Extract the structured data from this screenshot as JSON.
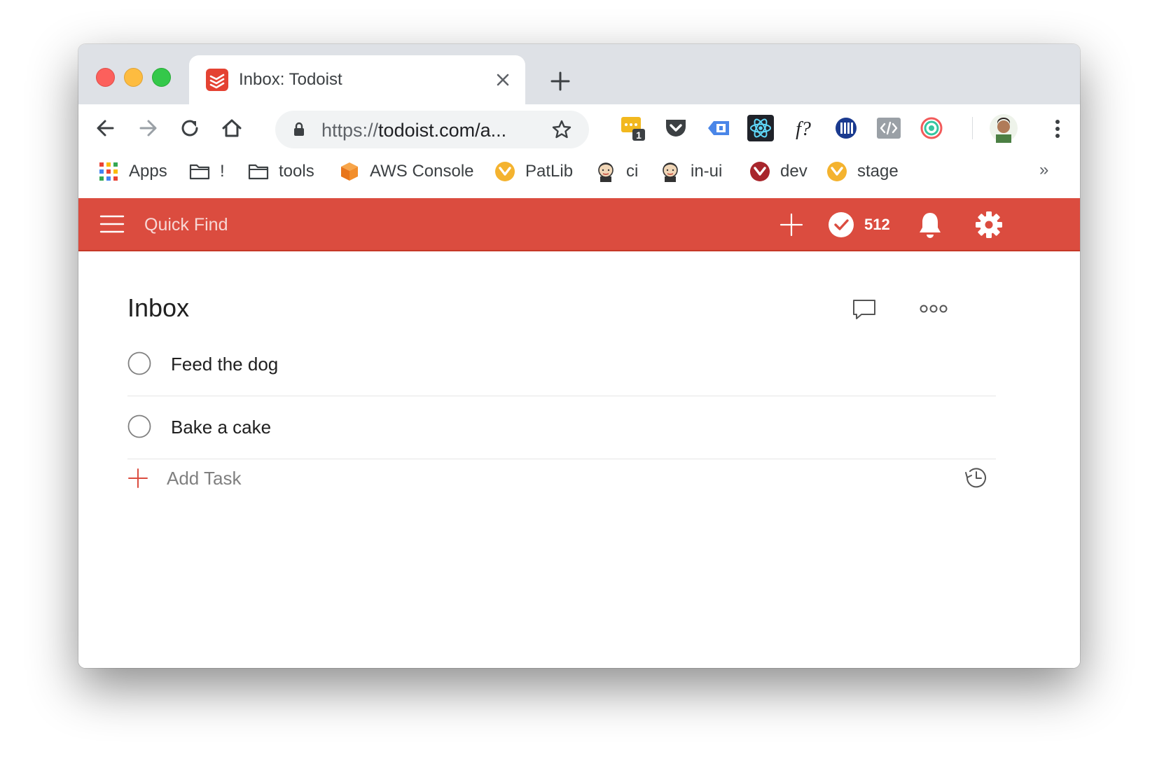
{
  "browser": {
    "tab": {
      "title": "Inbox: Todoist"
    },
    "omnibox": {
      "url_scheme": "https://",
      "url_rest": "todoist.com/a..."
    },
    "extensions": [
      {
        "name": "chat-extension",
        "badge": "1"
      },
      {
        "name": "pocket"
      },
      {
        "name": "ext-blue"
      },
      {
        "name": "react-devtools"
      },
      {
        "name": "fontface-ninja",
        "label": "f?"
      },
      {
        "name": "ext-stripes"
      },
      {
        "name": "view-source"
      },
      {
        "name": "ext-target"
      }
    ],
    "bookmarks": [
      {
        "label": "Apps",
        "icon": "apps-grid-icon"
      },
      {
        "label": "!",
        "icon": "folder-icon"
      },
      {
        "label": "tools",
        "icon": "folder-icon"
      },
      {
        "label": "AWS Console",
        "icon": "aws-cube-icon"
      },
      {
        "label": "PatLib",
        "icon": "orange-circle-icon"
      },
      {
        "label": "ci",
        "icon": "jenkins-icon"
      },
      {
        "label": "in-ui",
        "icon": "jenkins-icon"
      },
      {
        "label": "dev",
        "icon": "red-circle-icon"
      },
      {
        "label": "stage",
        "icon": "orange-circle-icon"
      }
    ],
    "bookmarks_overflow": "»"
  },
  "app": {
    "brand_color": "#db4c3f",
    "quick_find_placeholder": "Quick Find",
    "karma_count": "512",
    "page_title": "Inbox",
    "tasks": [
      {
        "text": "Feed the dog"
      },
      {
        "text": "Bake a cake"
      }
    ],
    "add_task_label": "Add Task"
  }
}
